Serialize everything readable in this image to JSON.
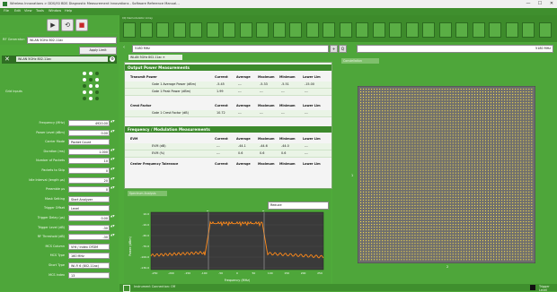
{
  "window": {
    "title": "Wireless Innovations > DDS/ISI BDS Diagnostic Measurement Innovations - Software Reference Manual...",
    "controls": [
      "—",
      "☐",
      "✕"
    ]
  },
  "menu": [
    "File",
    "Edit",
    "View",
    "Tools",
    "Window",
    "Help"
  ],
  "toolbar": {
    "play_icon": "▶",
    "loop_icon": "⟲",
    "stop_icon": "■"
  },
  "blocks_header": "I/Q Demodulator Array",
  "rf": {
    "label": "RF Generator:",
    "selected": "WLAN 5GHz 802.11ac",
    "apply_label": "Apply Limit"
  },
  "freqbar": {
    "left_value": "5180 MHz",
    "right_value": "5180 MHz",
    "btn1": "+",
    "btn2": "Q"
  },
  "leftpanel": {
    "header_select": "WLAN 5GHz 802.11ac",
    "close_icon": "✕",
    "gear_icon": "⚙",
    "iq_label": "Grid Inputs",
    "params": [
      {
        "label": "Frequency (MHz)",
        "value": "4920.00",
        "type": "num"
      },
      {
        "label": "Power Level (dBm)",
        "value": "0.00",
        "type": "num"
      },
      {
        "label": "Carrier Mode",
        "value": "Packet Count",
        "type": "dd"
      },
      {
        "label": "Duration (ms)",
        "value": "1.000",
        "type": "num"
      },
      {
        "label": "Number of Packets",
        "value": "10",
        "type": "num"
      },
      {
        "label": "Packets to Skip",
        "value": "0",
        "type": "num"
      },
      {
        "label": "Idle Interval (length µs)",
        "value": "20",
        "type": "num"
      },
      {
        "label": "Preamble µs",
        "value": "0",
        "type": "num"
      },
      {
        "label": "Mask Setting",
        "value": "Start Analyzer",
        "type": "dd"
      },
      {
        "label": "Trigger Offset",
        "value": "Level",
        "type": "dd"
      },
      {
        "label": "Trigger Delay (µs)",
        "value": "0.00",
        "type": "num"
      },
      {
        "label": "Trigger Level (dB)",
        "value": "-30",
        "type": "num"
      },
      {
        "label": "RF Threshold (dB)",
        "value": "-30",
        "type": "num"
      },
      {
        "label": "MCS Column",
        "value": "VHt / Index OFDM",
        "type": "dd"
      },
      {
        "label": "MCS Type",
        "value": "160 MHz",
        "type": "dd"
      },
      {
        "label": "Short Type",
        "value": "Wi-Fi 6 (802.11ax)",
        "type": "dd"
      },
      {
        "label": "MCS Index",
        "value": "13",
        "type": "dd"
      }
    ]
  },
  "tab": {
    "label": "WLAN 5GHz 802.11ac ✕"
  },
  "meas": {
    "section1": "Output Power Measurements",
    "tx_hdr": [
      "Transmit Power",
      "Current",
      "Average",
      "Maximum",
      "Minimum",
      "Lower Lim"
    ],
    "tx_rows": [
      [
        "Gate 1 Average Power (dBm)",
        "-5.45",
        "---",
        "-5.33",
        "-5.51",
        "-15.00"
      ],
      [
        "Gate 1 Peak Power (dBm)",
        "1.99",
        "---",
        "---",
        "---",
        "---"
      ]
    ],
    "cf_hdr": [
      "Crest Factor",
      "Current",
      "Average",
      "Maximum",
      "Minimum",
      "Lower Lim"
    ],
    "cf_rows": [
      [
        "Gate 1 Crest Factor (dB)",
        "10.72",
        "---",
        "---",
        "---",
        "---"
      ]
    ],
    "section2": "Frequency / Modulation Measurements",
    "evm_hdr": [
      "EVM",
      "Current",
      "Average",
      "Maximum",
      "Minimum",
      "Lower Lim"
    ],
    "evm_rows": [
      [
        "EVM (dB)",
        "---",
        "-44.1",
        "-44.6",
        "-44.0",
        "---"
      ],
      [
        "EVM (%)",
        "---",
        "0.6",
        "0.6",
        "0.6",
        "---"
      ]
    ],
    "cft_hdr": [
      "Center Frequency Tolerance",
      "Current",
      "Average",
      "Maximum",
      "Minimum",
      "Lower Lim"
    ]
  },
  "graph": {
    "tab": "Spectrum Analysis",
    "range_select": "Reduce",
    "ylabel": "Power (dBm)",
    "xlabel": "Frequency (MHz)",
    "yticks": [
      "10.0",
      "-10.0",
      "-40.0",
      "-70.0",
      "-100.0",
      "-130.0"
    ],
    "xticks": [
      "-250",
      "-200",
      "-150",
      "-100",
      "-50",
      "0",
      "50",
      "100",
      "150",
      "200",
      "250"
    ],
    "marker_a": "A",
    "marker_b": "B"
  },
  "rightpanel": {
    "tab": "Constellation",
    "mark_left": "1",
    "mark_bottom": "2"
  },
  "status": {
    "text": "Instrument Connection: Off",
    "right_text": "Trigger Level"
  }
}
